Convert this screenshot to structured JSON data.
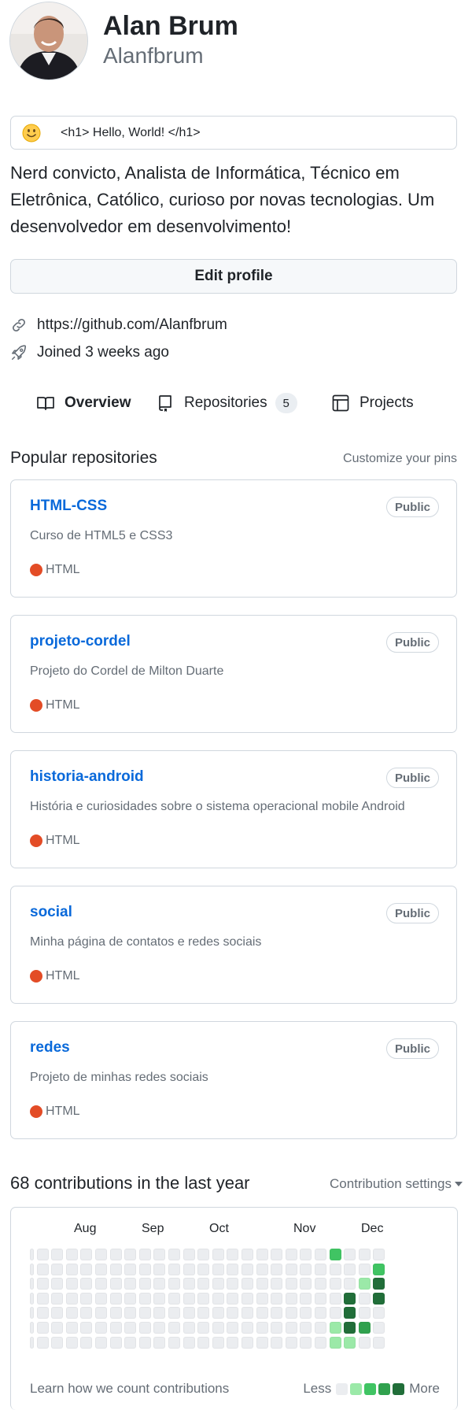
{
  "profile": {
    "name": "Alan Brum",
    "login": "Alanfbrum",
    "status_message": "<h1> Hello, World! </h1>",
    "bio": "Nerd convicto, Analista de Informática, Técnico em Eletrônica, Católico, curioso por novas tecnologias. Um desenvolvedor em desenvolvimento!",
    "edit_button": "Edit profile",
    "website": "https://github.com/Alanfbrum",
    "joined": "Joined 3 weeks ago"
  },
  "tabs": [
    {
      "label": "Overview",
      "icon": "book-icon",
      "active": true
    },
    {
      "label": "Repositories",
      "icon": "repo-icon",
      "count": "5"
    },
    {
      "label": "Projects",
      "icon": "project-icon"
    }
  ],
  "popular": {
    "title": "Popular repositories",
    "customize": "Customize your pins",
    "repos": [
      {
        "name": "HTML-CSS",
        "visibility": "Public",
        "description": "Curso de HTML5 e CSS3",
        "language": "HTML",
        "lang_color": "#e34c26"
      },
      {
        "name": "projeto-cordel",
        "visibility": "Public",
        "description": "Projeto do Cordel de Milton Duarte",
        "language": "HTML",
        "lang_color": "#e34c26"
      },
      {
        "name": "historia-android",
        "visibility": "Public",
        "description": "História e curiosidades sobre o sistema operacional mobile Android",
        "language": "HTML",
        "lang_color": "#e34c26"
      },
      {
        "name": "social",
        "visibility": "Public",
        "description": "Minha página de contatos e redes sociais",
        "language": "HTML",
        "lang_color": "#e34c26"
      },
      {
        "name": "redes",
        "visibility": "Public",
        "description": "Projeto de minhas redes sociais",
        "language": "HTML",
        "lang_color": "#e34c26"
      }
    ]
  },
  "contributions": {
    "title": "68 contributions in the last year",
    "settings": "Contribution settings",
    "months": [
      "Aug",
      "Sep",
      "Oct",
      "Nov",
      "Dec"
    ],
    "learn": "Learn how we count contributions",
    "less": "Less",
    "more": "More",
    "level_colors": [
      "#ebedf0",
      "#9be9a8",
      "#40c463",
      "#30a14e",
      "#216e39"
    ],
    "active_cells": [
      {
        "week": 21,
        "day": 0,
        "level": 2
      },
      {
        "week": 24,
        "day": 1,
        "level": 2
      },
      {
        "week": 23,
        "day": 2,
        "level": 1
      },
      {
        "week": 24,
        "day": 2,
        "level": 4
      },
      {
        "week": 22,
        "day": 3,
        "level": 4
      },
      {
        "week": 24,
        "day": 3,
        "level": 4
      },
      {
        "week": 22,
        "day": 4,
        "level": 4
      },
      {
        "week": 21,
        "day": 5,
        "level": 1
      },
      {
        "week": 22,
        "day": 5,
        "level": 4
      },
      {
        "week": 23,
        "day": 5,
        "level": 3
      },
      {
        "week": 21,
        "day": 6,
        "level": 1
      },
      {
        "week": 22,
        "day": 6,
        "level": 1
      }
    ]
  },
  "colors": {
    "accent_link": "#0969da",
    "muted_text": "#656d76",
    "border": "#d0d7de"
  }
}
